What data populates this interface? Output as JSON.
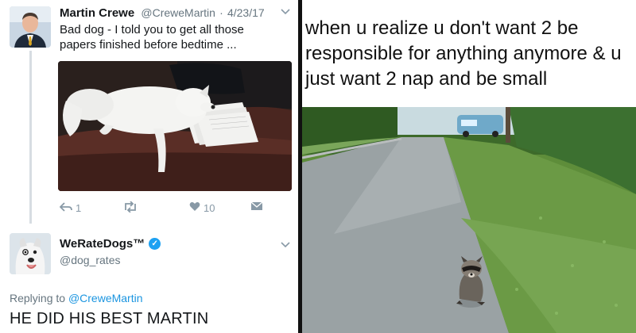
{
  "tweet1": {
    "name": "Martin Crewe",
    "handle": "@CreweMartin",
    "dot": "·",
    "date": "4/23/17",
    "text": "Bad dog - I told you to get all those papers finished before bedtime ...",
    "reply_count": "1",
    "like_count": "10",
    "icons": [
      "reply-icon",
      "retweet-icon",
      "heart-icon",
      "dm-icon",
      "chevron-down-icon"
    ]
  },
  "tweet2": {
    "name": "WeRateDogs™",
    "handle": "@dog_rates",
    "replying_prefix": "Replying to",
    "replying_handle": "@CreweMartin",
    "text": "HE DID HIS BEST MARTIN"
  },
  "meme": {
    "caption": "when u realize u don't want 2 be responsible for anything anymore & u just want 2 nap and be small"
  },
  "colors": {
    "link": "#1b95e0",
    "verified": "#1da1f2",
    "muted": "#66757f",
    "divider": "#111111"
  }
}
